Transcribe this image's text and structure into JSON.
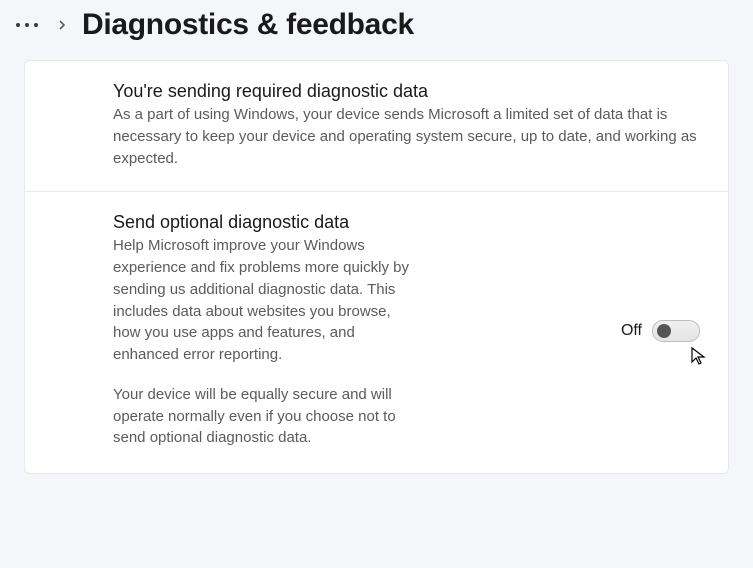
{
  "header": {
    "title": "Diagnostics & feedback"
  },
  "sections": {
    "required": {
      "title": "You're sending required diagnostic data",
      "desc": "As a part of using Windows, your device sends Microsoft a limited set of data that is necessary to keep your device and operating system secure, up to date, and working as expected."
    },
    "optional": {
      "title": "Send optional diagnostic data",
      "desc": "Help Microsoft improve your Windows experience and fix problems more quickly by sending us additional diagnostic data. This includes data about websites you browse, how you use apps and features, and enhanced error reporting.",
      "desc2": "Your device will be equally secure and will operate normally even if you choose not to send optional diagnostic data.",
      "toggle_label": "Off",
      "toggle_state": false
    }
  }
}
